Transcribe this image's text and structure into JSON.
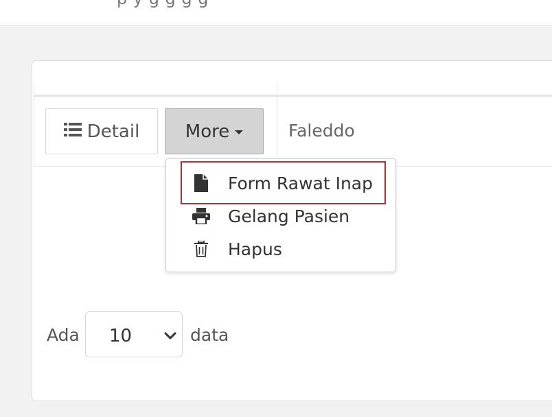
{
  "header": {
    "partial_text": "p  y   g   g   g  g"
  },
  "row": {
    "detail_label": "Detail",
    "more_label": "More",
    "name": "Faleddo"
  },
  "dropdown": {
    "items": [
      {
        "label": "Form Rawat Inap",
        "icon": "file-icon"
      },
      {
        "label": "Gelang Pasien",
        "icon": "print-icon"
      },
      {
        "label": "Hapus",
        "icon": "trash-icon"
      }
    ]
  },
  "pagination": {
    "prefix": "Ada",
    "page_size": "10",
    "suffix": "data"
  },
  "colors": {
    "highlight": "#c62828",
    "more_button_bg": "#d4d4d4"
  }
}
